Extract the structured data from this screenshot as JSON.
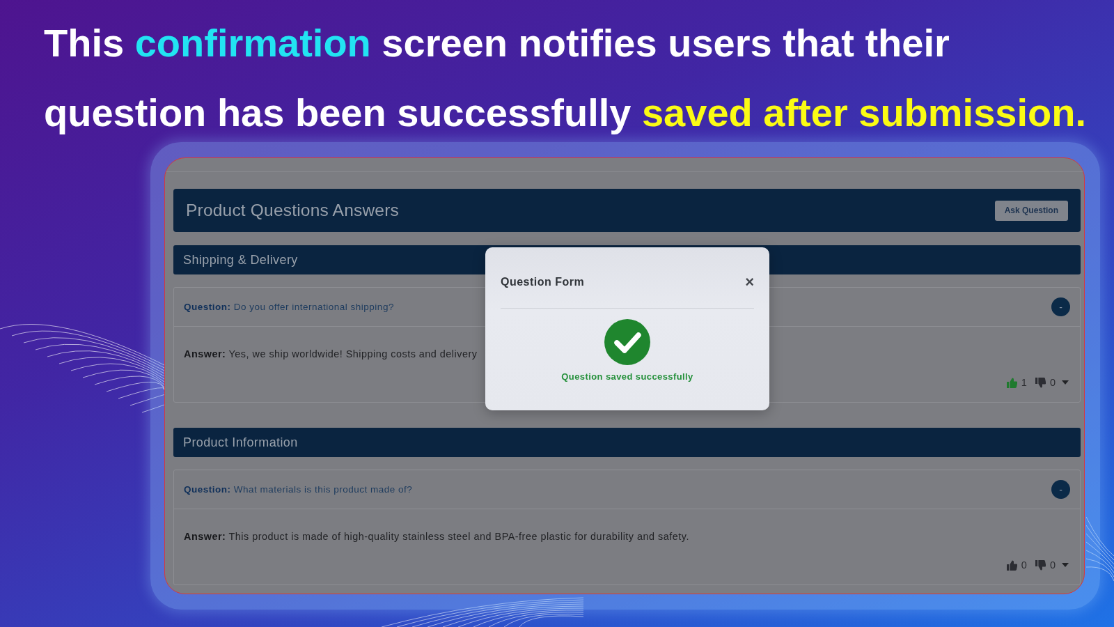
{
  "headline": [
    {
      "text": "This ",
      "color": "#ffffff"
    },
    {
      "text": "confirmation",
      "color": "#22e4f2"
    },
    {
      "text": " screen notifies users that their question has been successfully ",
      "color": "#ffffff"
    },
    {
      "text": "saved after submission.",
      "color": "#fbfb14"
    }
  ],
  "panel": {
    "title": "Product Questions Answers",
    "ask_button": "Ask Question",
    "sections": [
      {
        "title": "Shipping & Delivery",
        "items": [
          {
            "question": "**Question:** Do you offer international shipping?",
            "toggle": "-",
            "answer": "**Answer:** Yes, we ship worldwide! Shipping costs and delivery",
            "likes": "1",
            "liked": true,
            "dislikes": "0"
          }
        ]
      },
      {
        "title": "Product Information",
        "items": [
          {
            "question": "**Question:** What materials is this product made of?",
            "toggle": "-",
            "answer": "**Answer:** This product is made of high-quality stainless steel and BPA-free plastic for durability and safety.",
            "likes": "0",
            "liked": false,
            "dislikes": "0"
          }
        ]
      }
    ]
  },
  "modal": {
    "title": "Question Form",
    "close": "×",
    "message": "Question saved successfully"
  }
}
